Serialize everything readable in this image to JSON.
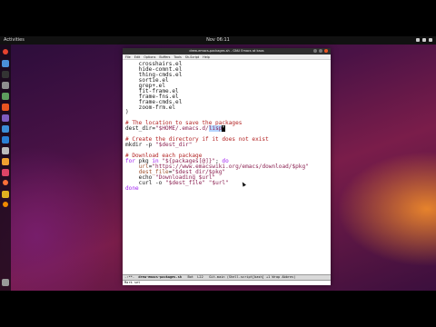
{
  "topbar": {
    "activities": "Activities",
    "clock": "Nov 06:11"
  },
  "window": {
    "title": "drew-emacs-packages.sh - GNU Emacs at kaos"
  },
  "menu": [
    "File",
    "Edit",
    "Options",
    "Buffers",
    "Tools",
    "Sh-Script",
    "Help"
  ],
  "code_lines": [
    [
      {
        "t": "    crosshairs.el"
      }
    ],
    [
      {
        "t": "    hide-comnt.el"
      }
    ],
    [
      {
        "t": "    thing-cmds.el"
      }
    ],
    [
      {
        "t": "    sortie.el"
      }
    ],
    [
      {
        "t": "    grep+.el"
      }
    ],
    [
      {
        "t": "    fit-frame.el"
      }
    ],
    [
      {
        "t": "    frame-fns.el"
      }
    ],
    [
      {
        "t": "    frame-cmds.el"
      }
    ],
    [
      {
        "t": "    zoom-frm.el"
      }
    ],
    [
      {
        "t": ")"
      }
    ],
    [
      {
        "t": ""
      }
    ],
    [
      {
        "t": "# The location to save the packages",
        "c": "c-com"
      }
    ],
    [
      {
        "t": "dest_dir="
      },
      {
        "t": "\"$HOME/.emacs.d/",
        "c": "c-str"
      },
      {
        "t": "lisp",
        "c": "c-str c-sel"
      },
      {
        "t": "\"",
        "c": "c-cursor"
      }
    ],
    [
      {
        "t": ""
      }
    ],
    [
      {
        "t": "# Create the directory if it does not exist",
        "c": "c-com"
      }
    ],
    [
      {
        "t": "mkdir -p "
      },
      {
        "t": "\"$dest_dir\"",
        "c": "c-str"
      }
    ],
    [
      {
        "t": ""
      }
    ],
    [
      {
        "t": "# Download each package",
        "c": "c-com"
      }
    ],
    [
      {
        "t": "for",
        "c": "c-kw"
      },
      {
        "t": " pkg "
      },
      {
        "t": "in",
        "c": "c-kw"
      },
      {
        "t": " "
      },
      {
        "t": "\"${packages[@]}\"",
        "c": "c-str"
      },
      {
        "t": "; "
      },
      {
        "t": "do",
        "c": "c-kw"
      }
    ],
    [
      {
        "t": "    "
      },
      {
        "t": "url",
        "c": "c-var"
      },
      {
        "t": "="
      },
      {
        "t": "\"https://www.emacswiki.org/emacs/download/$pkg\"",
        "c": "c-str"
      }
    ],
    [
      {
        "t": "    "
      },
      {
        "t": "dest_file",
        "c": "c-var"
      },
      {
        "t": "="
      },
      {
        "t": "\"$dest_dir/$pkg\"",
        "c": "c-str"
      }
    ],
    [
      {
        "t": "    echo "
      },
      {
        "t": "\"Downloading $url\"",
        "c": "c-str"
      }
    ],
    [
      {
        "t": "    curl -o "
      },
      {
        "t": "\"$dest_file\"",
        "c": "c-str"
      },
      {
        "t": " "
      },
      {
        "t": "\"$url\"",
        "c": "c-str"
      }
    ],
    [
      {
        "t": "done",
        "c": "c-kw"
      }
    ]
  ],
  "modeline": {
    "status": "-:**-",
    "filename": "drew-emacs-packages.sh",
    "position": "Bot",
    "line": "L22",
    "mode": "Git-main  (Shell-script[bash] +1 Wrap Abbrev)"
  },
  "echo_area": "Mark set",
  "colors": {
    "comment": "#b22222",
    "string": "#8b2252",
    "keyword": "#a020f0",
    "variable": "#a0522d",
    "region": "#b5d5ff"
  },
  "dock_icons": [
    {
      "name": "chrome-icon",
      "color": "#e6432f"
    },
    {
      "name": "files-icon",
      "color": "#4a90d9"
    },
    {
      "name": "terminal-icon",
      "color": "#333333"
    },
    {
      "name": "settings-icon",
      "color": "#8e8e8e"
    },
    {
      "name": "text-editor-icon",
      "color": "#5d9c5d"
    },
    {
      "name": "software-icon",
      "color": "#e95420"
    },
    {
      "name": "emacs-icon",
      "color": "#7e5bbf"
    },
    {
      "name": "help-icon",
      "color": "#3c8dd6"
    },
    {
      "name": "vscode-icon",
      "color": "#2a7fd4"
    },
    {
      "name": "camera-icon",
      "color": "#bbbbbb"
    },
    {
      "name": "music-icon",
      "color": "#f0a030"
    },
    {
      "name": "photos-icon",
      "color": "#dd4466"
    },
    {
      "name": "firefox-icon",
      "color": "#ff7139"
    },
    {
      "name": "store-icon",
      "color": "#e0b020"
    },
    {
      "name": "vlc-icon",
      "color": "#f08a00"
    },
    {
      "name": "trash-icon",
      "color": "#999999"
    }
  ]
}
